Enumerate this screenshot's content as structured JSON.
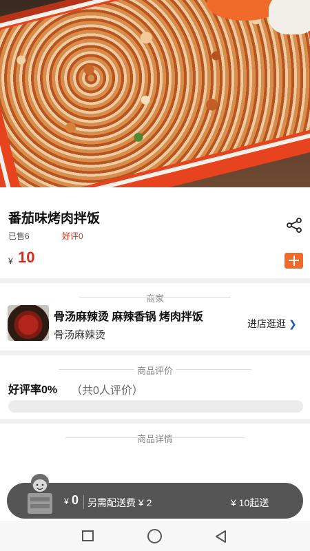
{
  "product": {
    "title": "番茄味烤肉拌饭",
    "sold": "已售6",
    "good_rating": "好评0",
    "price_symbol": "¥",
    "price": "10"
  },
  "merchant": {
    "section_label": "商家",
    "name": "骨汤麻辣烫 麻辣香锅 烤肉拌饭",
    "subtitle": "骨汤麻辣烫",
    "visit_label": "进店逛逛",
    "visit_chevron": "❯"
  },
  "reviews": {
    "section_label": "商品评价",
    "good_rate": "好评率0%",
    "count_text": "（共0人评价）",
    "good_rate_value": 0
  },
  "details": {
    "section_label": "商品详情"
  },
  "cart": {
    "total_symbol": "¥",
    "total": "0",
    "delivery_fee": "另需配送费 ¥ 2",
    "min_order": "¥ 10起送"
  },
  "icons": {
    "share": "share-icon",
    "add": "add-icon",
    "cart_mascot": "cart-mascot-icon",
    "nav_recent": "square-icon",
    "nav_home": "circle-icon",
    "nav_back": "triangle-back-icon"
  },
  "colors": {
    "accent": "#f26a2a",
    "price": "#e0271b",
    "rating": "#e02a1f",
    "cart_bar": "#555555",
    "link_chevron": "#1a5fb4"
  }
}
